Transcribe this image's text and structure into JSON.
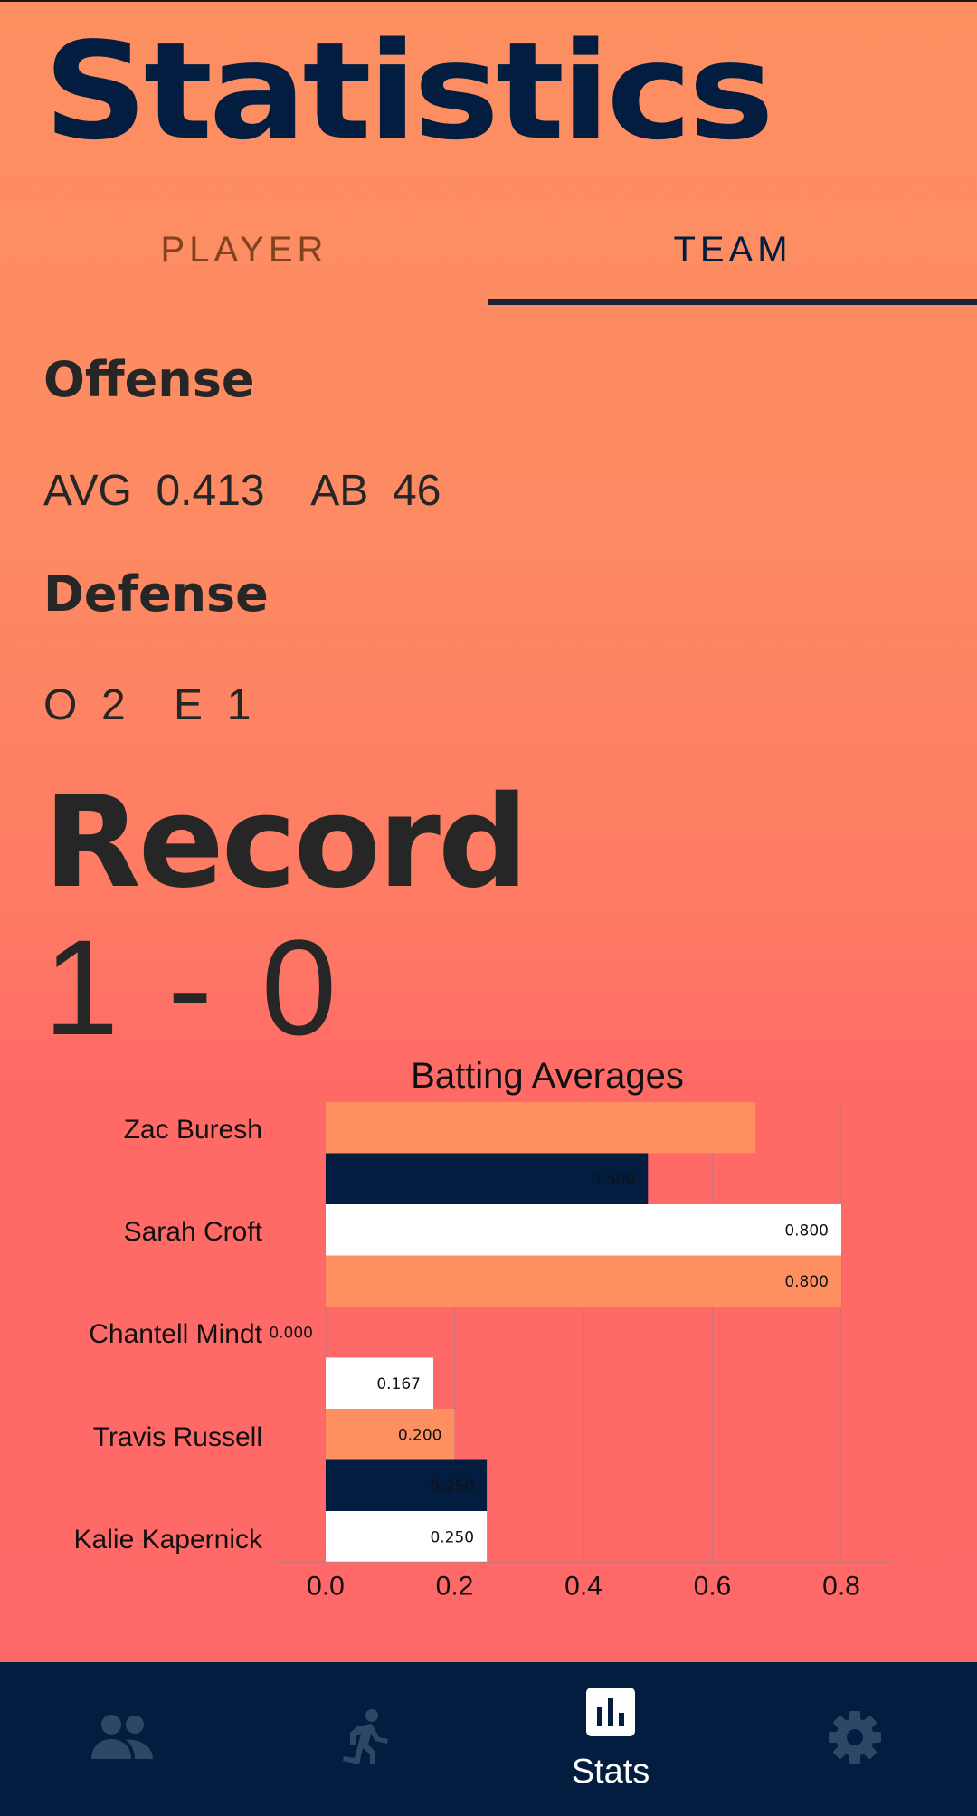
{
  "header": {
    "title": "Statistics"
  },
  "tabs": {
    "player": "PLAYER",
    "team": "TEAM",
    "selected": "TEAM"
  },
  "offense": {
    "heading": "Offense",
    "line": "AVG  0.413    AB  46"
  },
  "defense": {
    "heading": "Defense",
    "line": "O  2    E  1"
  },
  "record": {
    "heading": "Record",
    "value": "1 - 0"
  },
  "chart_data": {
    "type": "bar",
    "orientation": "horizontal",
    "title": "Batting Averages",
    "xlabel": "",
    "ylabel": "",
    "xlim": [
      0,
      0.8
    ],
    "xticks": [
      "0.0",
      "0.2",
      "0.4",
      "0.6",
      "0.8"
    ],
    "grid": true,
    "player_labels": [
      "Zac Buresh",
      "Sarah Croft",
      "Chantell Mindt",
      "Travis Russell",
      "Kalie Kapernick"
    ],
    "bars": [
      {
        "value": 0.667,
        "label": "",
        "color": "#fd8f61"
      },
      {
        "value": 0.5,
        "label": "0.500",
        "color": "#021d3f"
      },
      {
        "value": 0.8,
        "label": "0.800",
        "color": "#ffffff"
      },
      {
        "value": 0.8,
        "label": "0.800",
        "color": "#fd8f61"
      },
      {
        "value": 0.0,
        "label": "0.000",
        "color": "#021d3f"
      },
      {
        "value": 0.167,
        "label": "0.167",
        "color": "#ffffff"
      },
      {
        "value": 0.2,
        "label": "0.200",
        "color": "#fd8f61"
      },
      {
        "value": 0.25,
        "label": "0.250",
        "color": "#021d3f"
      },
      {
        "value": 0.25,
        "label": "0.250",
        "color": "#ffffff"
      }
    ]
  },
  "nav": {
    "items": [
      {
        "icon": "people-icon",
        "label": ""
      },
      {
        "icon": "runner-icon",
        "label": ""
      },
      {
        "icon": "bar-chart-icon",
        "label": "Stats"
      },
      {
        "icon": "gear-icon",
        "label": ""
      }
    ]
  },
  "colors": {
    "navy": "#021d3f",
    "orange": "#fd8f61",
    "coral": "#ff6868",
    "icon_inactive": "#2e4767"
  }
}
